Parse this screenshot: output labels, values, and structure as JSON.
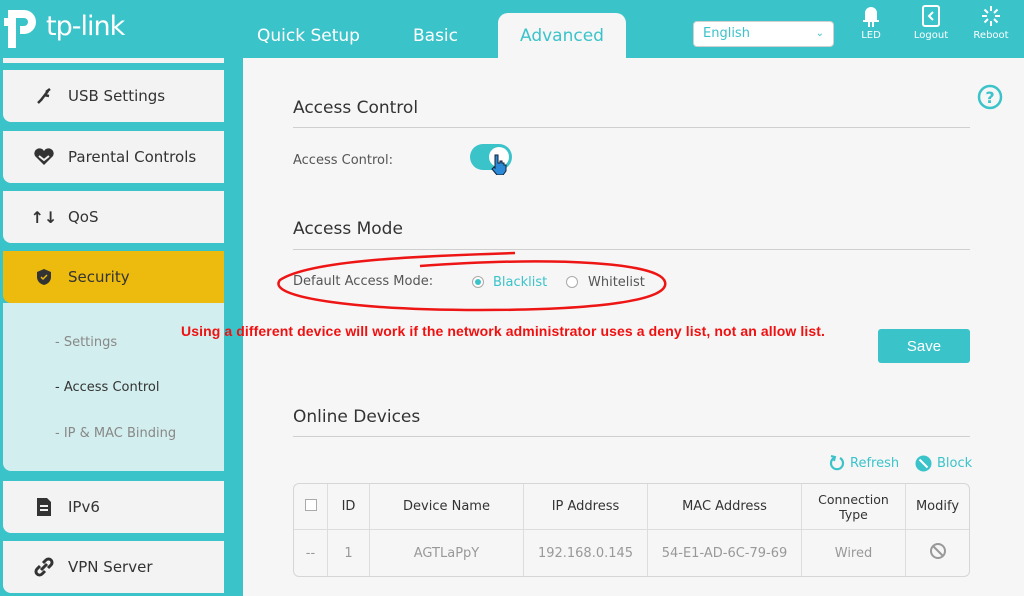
{
  "brand": {
    "logo_text": "tp-link",
    "accent": "#3bc3ca",
    "highlight": "#ecbb0e"
  },
  "nav": {
    "tabs": [
      {
        "label": "Quick Setup"
      },
      {
        "label": "Basic"
      },
      {
        "label": "Advanced",
        "active": true
      }
    ]
  },
  "language": {
    "selected": "English"
  },
  "header_buttons": [
    {
      "label": "LED",
      "icon": "led-icon"
    },
    {
      "label": "Logout",
      "icon": "logout-icon"
    },
    {
      "label": "Reboot",
      "icon": "reboot-icon"
    }
  ],
  "sidebar": {
    "items": [
      {
        "label": "USB Settings",
        "icon": "usb-icon"
      },
      {
        "label": "Parental Controls",
        "icon": "heart-icon"
      },
      {
        "label": "QoS",
        "icon": "arrows-updown-icon"
      },
      {
        "label": "Security",
        "icon": "shield-icon",
        "active": true
      },
      {
        "label": "IPv6",
        "icon": "ipv6-icon"
      },
      {
        "label": "VPN Server",
        "icon": "link-icon"
      }
    ],
    "security_sub": [
      {
        "label": "- Settings"
      },
      {
        "label": "- Access Control",
        "active": true
      },
      {
        "label": "- IP & MAC Binding"
      }
    ]
  },
  "access_control": {
    "title": "Access Control",
    "label": "Access Control:",
    "enabled": true
  },
  "access_mode": {
    "title": "Access Mode",
    "label": "Default Access Mode:",
    "options": [
      "Blacklist",
      "Whitelist"
    ],
    "selected": "Blacklist"
  },
  "annotation": "Using a different device will work if the network administrator uses a deny list, not an allow list.",
  "save_label": "Save",
  "online_devices": {
    "title": "Online Devices",
    "refresh_label": "Refresh",
    "block_label": "Block",
    "columns": [
      "ID",
      "Device Name",
      "IP Address",
      "MAC Address",
      "Connection Type",
      "Modify"
    ],
    "rows": [
      {
        "check": "--",
        "id": "1",
        "name": "AGTLaPpY",
        "ip": "192.168.0.145",
        "mac": "54-E1-AD-6C-79-69",
        "type": "Wired"
      }
    ]
  }
}
